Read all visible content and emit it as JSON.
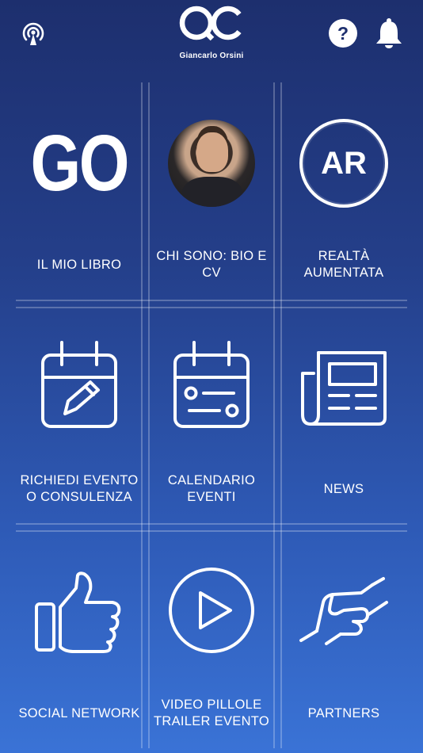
{
  "header": {
    "left_icon": "broadcast-icon",
    "logo_icon": "go-logo-icon",
    "brand_name": "Giancarlo Orsini",
    "help_icon": "help-icon",
    "notification_icon": "bell-icon"
  },
  "grid": {
    "tiles": [
      {
        "label": "IL MIO LIBRO",
        "icon": "go-text",
        "icon_text": "GO"
      },
      {
        "label": "CHI SONO: BIO E CV",
        "icon": "avatar"
      },
      {
        "label": "REALTÀ AUMENTATA",
        "icon": "ar-icon",
        "icon_text": "AR"
      },
      {
        "label": "RICHIEDI EVENTO O CONSULENZA",
        "icon": "calendar-edit-icon"
      },
      {
        "label": "CALENDARIO EVENTI",
        "icon": "calendar-icon"
      },
      {
        "label": "NEWS",
        "icon": "newspaper-icon"
      },
      {
        "label": "SOCIAL NETWORK",
        "icon": "thumbs-up-icon"
      },
      {
        "label": "VIDEO PILLOLE TRAILER EVENTO",
        "icon": "play-icon"
      },
      {
        "label": "PARTNERS",
        "icon": "handshake-icon"
      }
    ]
  },
  "colors": {
    "background_top": "#1d2f6e",
    "background_bottom": "#3a73d6",
    "foreground": "#ffffff"
  }
}
